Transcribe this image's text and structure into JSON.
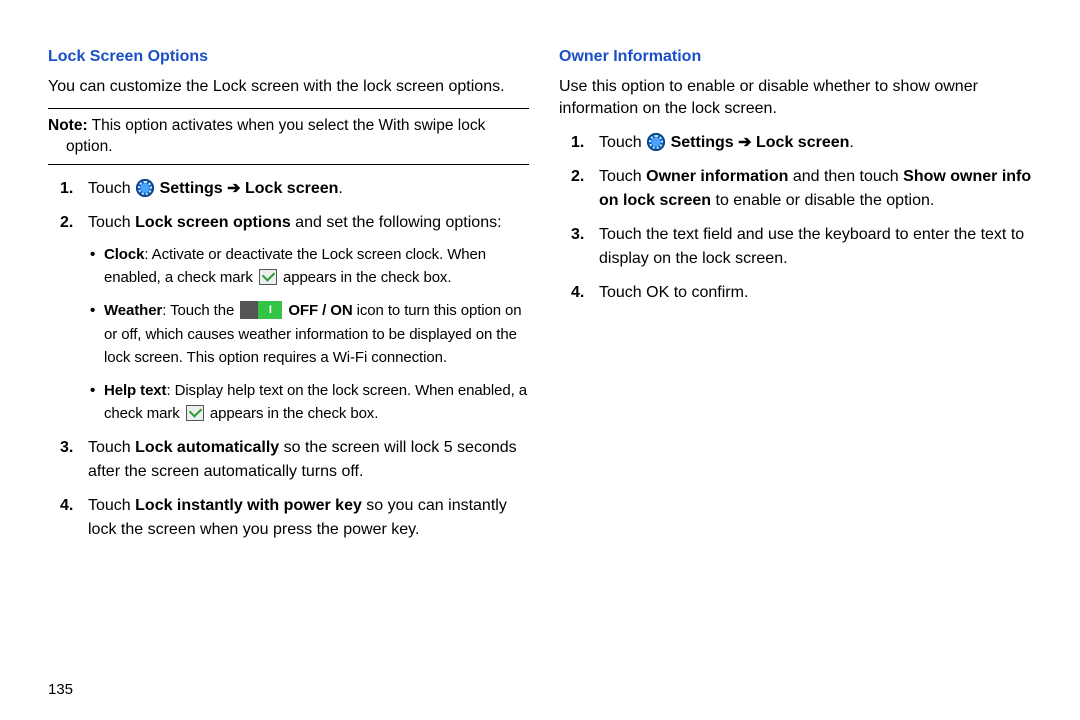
{
  "page_number": "135",
  "left": {
    "heading": "Lock Screen Options",
    "intro": "You can customize the Lock screen with the lock screen options.",
    "note_label": "Note:",
    "note_text": " This option activates when you select the With swipe lock option.",
    "steps": {
      "s1_pre": "Touch ",
      "s1_settings": " Settings",
      "s1_arrow": " ➔ ",
      "s1_lock": "Lock screen",
      "s1_end": ".",
      "s2_pre": "Touch ",
      "s2_bold": "Lock screen options",
      "s2_post": " and set the following options:",
      "s2b1_bold": "Clock",
      "s2b1_a": ": Activate or deactivate the Lock screen clock. When enabled, a check mark ",
      "s2b1_b": " appears in the check box.",
      "s2b2_bold": "Weather",
      "s2b2_a": ": Touch the ",
      "s2b2_offon": " OFF / ON",
      "s2b2_b": " icon to turn this option on or off, which causes weather information to be displayed on the lock screen. This option requires a Wi-Fi connection.",
      "s2b3_bold": "Help text",
      "s2b3_a": ": Display help text on the lock screen. When enabled, a check mark ",
      "s2b3_b": " appears in the check box.",
      "s3_pre": "Touch ",
      "s3_bold": "Lock automatically",
      "s3_post": " so the screen will lock 5 seconds after the screen automatically turns off.",
      "s4_pre": "Touch ",
      "s4_bold": "Lock instantly with power key",
      "s4_post": " so you can instantly lock the screen when you press the power key."
    }
  },
  "right": {
    "heading": "Owner Information",
    "intro": "Use this option to enable or disable whether to show owner information on the lock screen.",
    "steps": {
      "s1_pre": "Touch ",
      "s1_settings": " Settings",
      "s1_arrow": " ➔ ",
      "s1_lock": "Lock screen",
      "s1_end": ".",
      "s2_pre": "Touch ",
      "s2_bold1": "Owner information",
      "s2_mid": " and then touch ",
      "s2_bold2": "Show owner info on lock screen",
      "s2_post": " to enable or disable the option.",
      "s3": "Touch the text field and use the keyboard to enter the text to display on the lock screen.",
      "s4": "Touch OK to confirm."
    }
  },
  "toggle_on_label": "I"
}
